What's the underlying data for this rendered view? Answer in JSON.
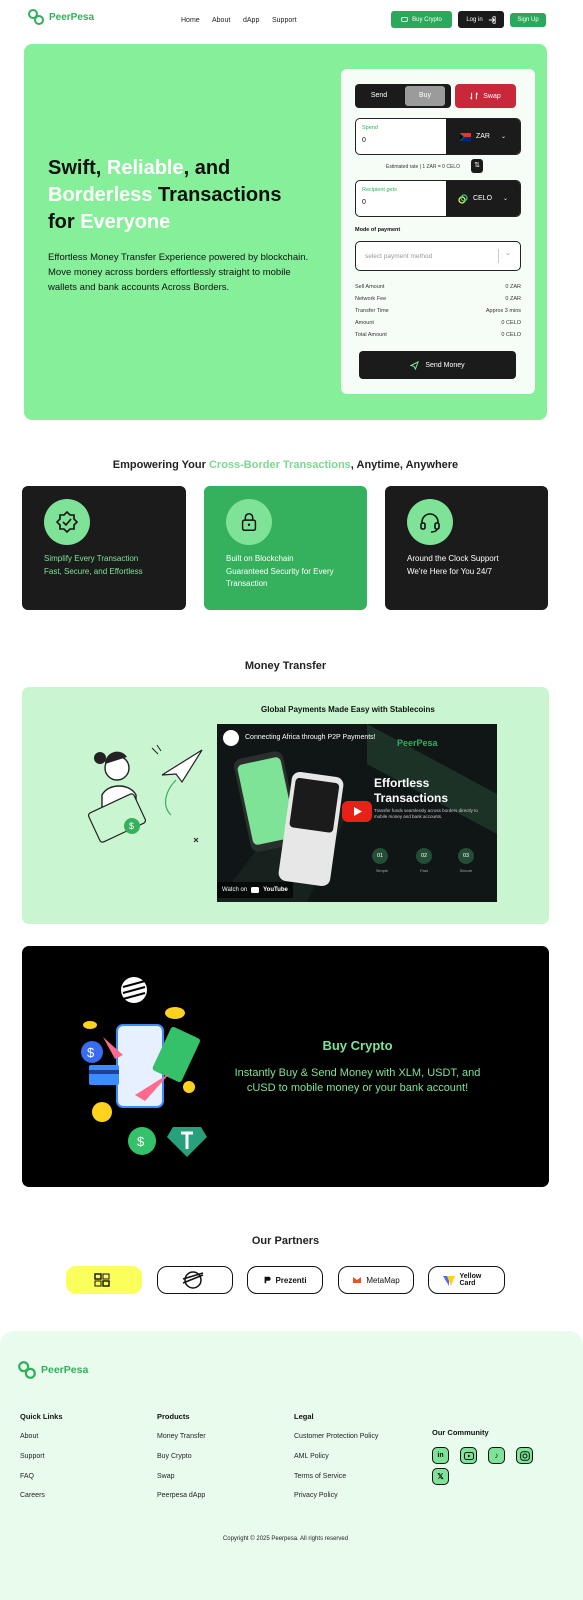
{
  "brand": {
    "name": "PeerPesa",
    "accent": "#2fb05c",
    "hero_bg": "#86ef9a"
  },
  "nav": {
    "links": [
      "Home",
      "About",
      "dApp",
      "Support"
    ],
    "buy_crypto": "Buy Crypto",
    "log_in": "Log in",
    "sign_up": "Sign Up"
  },
  "hero": {
    "title_1": "Swift, ",
    "title_2": "Reliable",
    "title_3": ", and",
    "title_4": "Borderless",
    "title_5": " Transactions",
    "title_6": "for ",
    "title_7": "Everyone",
    "subtitle": "Effortless Money Transfer Experience powered by blockchain. Move money across borders effortlessly straight to mobile wallets and bank accounts Across Borders."
  },
  "form": {
    "tabs": [
      "Send",
      "Buy"
    ],
    "active_tab": "Buy",
    "swap": "Swap",
    "spend_label": "Spend",
    "spend_value": "0",
    "spend_currency": "ZAR",
    "estimated_rate": "Estimated rate | 1 ZAR = 0 CELO",
    "recipient_label": "Recipient gets",
    "recipient_value": "0",
    "recipient_currency": "CELO",
    "payment_label": "Mode of payment",
    "payment_placeholder": "select payment method",
    "summary": [
      {
        "label": "Sell Amount",
        "value": "0 ZAR"
      },
      {
        "label": "Network Fee",
        "value": "0 ZAR"
      },
      {
        "label": "Transfer Time",
        "value": "Approx 3 mins"
      },
      {
        "label": "Amount",
        "value": "0 CELO"
      },
      {
        "label": "Total Amount",
        "value": "0 CELO"
      }
    ],
    "send_button": "Send Money"
  },
  "features": {
    "title_1": "Empowering Your ",
    "title_2": "Cross-Border Transactions",
    "title_3": ", Anytime, Anywhere",
    "cards": [
      {
        "line1": "Simplify Every Transaction",
        "line2": "Fast, Secure, and Effortless",
        "icon": "badge-check-icon"
      },
      {
        "line1": "Built on Blockchain",
        "line2": "Guaranteed Security for Every Transaction",
        "icon": "lock-icon"
      },
      {
        "line1": "Around the Clock Support",
        "line2": "We're Here for You 24/7",
        "icon": "headset-icon"
      }
    ]
  },
  "money_transfer": {
    "title": "Money Transfer",
    "subtitle": "Global Payments Made Easy with Stablecoins",
    "video": {
      "title": "Connecting Africa through P2P Payments!",
      "brand": "PeerPesa",
      "headline_1": "Effortless",
      "headline_2": "Transactions",
      "body": "Transfer funds seamlessly across borders directly to mobile money and bank accounts.",
      "steps": [
        "01",
        "02",
        "03"
      ],
      "step_labels": [
        "Simple",
        "Fast",
        "Secure"
      ],
      "watch_on": "Watch on",
      "youtube": "YouTube"
    }
  },
  "buy_crypto": {
    "title": "Buy Crypto",
    "text": "Instantly Buy & Send Money with XLM, USDT, and cUSD to mobile money or your bank account!"
  },
  "partners": {
    "title": "Our Partners",
    "items": [
      "",
      "",
      "Prezenti",
      "MetaMap",
      "Yellow Card"
    ]
  },
  "footer": {
    "brand": "PeerPesa",
    "cols": [
      {
        "title": "Quick Links",
        "links": [
          "About",
          "Support",
          "FAQ",
          "Careers"
        ]
      },
      {
        "title": "Products",
        "links": [
          "Money Transfer",
          "Buy Crypto",
          "Swap",
          "Peerpesa dApp"
        ]
      },
      {
        "title": "Legal",
        "links": [
          "Customer Protection Policy",
          "AML Policy",
          "Terms of Service",
          "Privacy Policy"
        ]
      }
    ],
    "community": "Our Community",
    "social": [
      "linkedin-icon",
      "youtube-icon",
      "tiktok-icon",
      "instagram-icon",
      "x-icon"
    ],
    "copyright": "Copyright © 2025 Peerpesa. All rights reserved"
  }
}
